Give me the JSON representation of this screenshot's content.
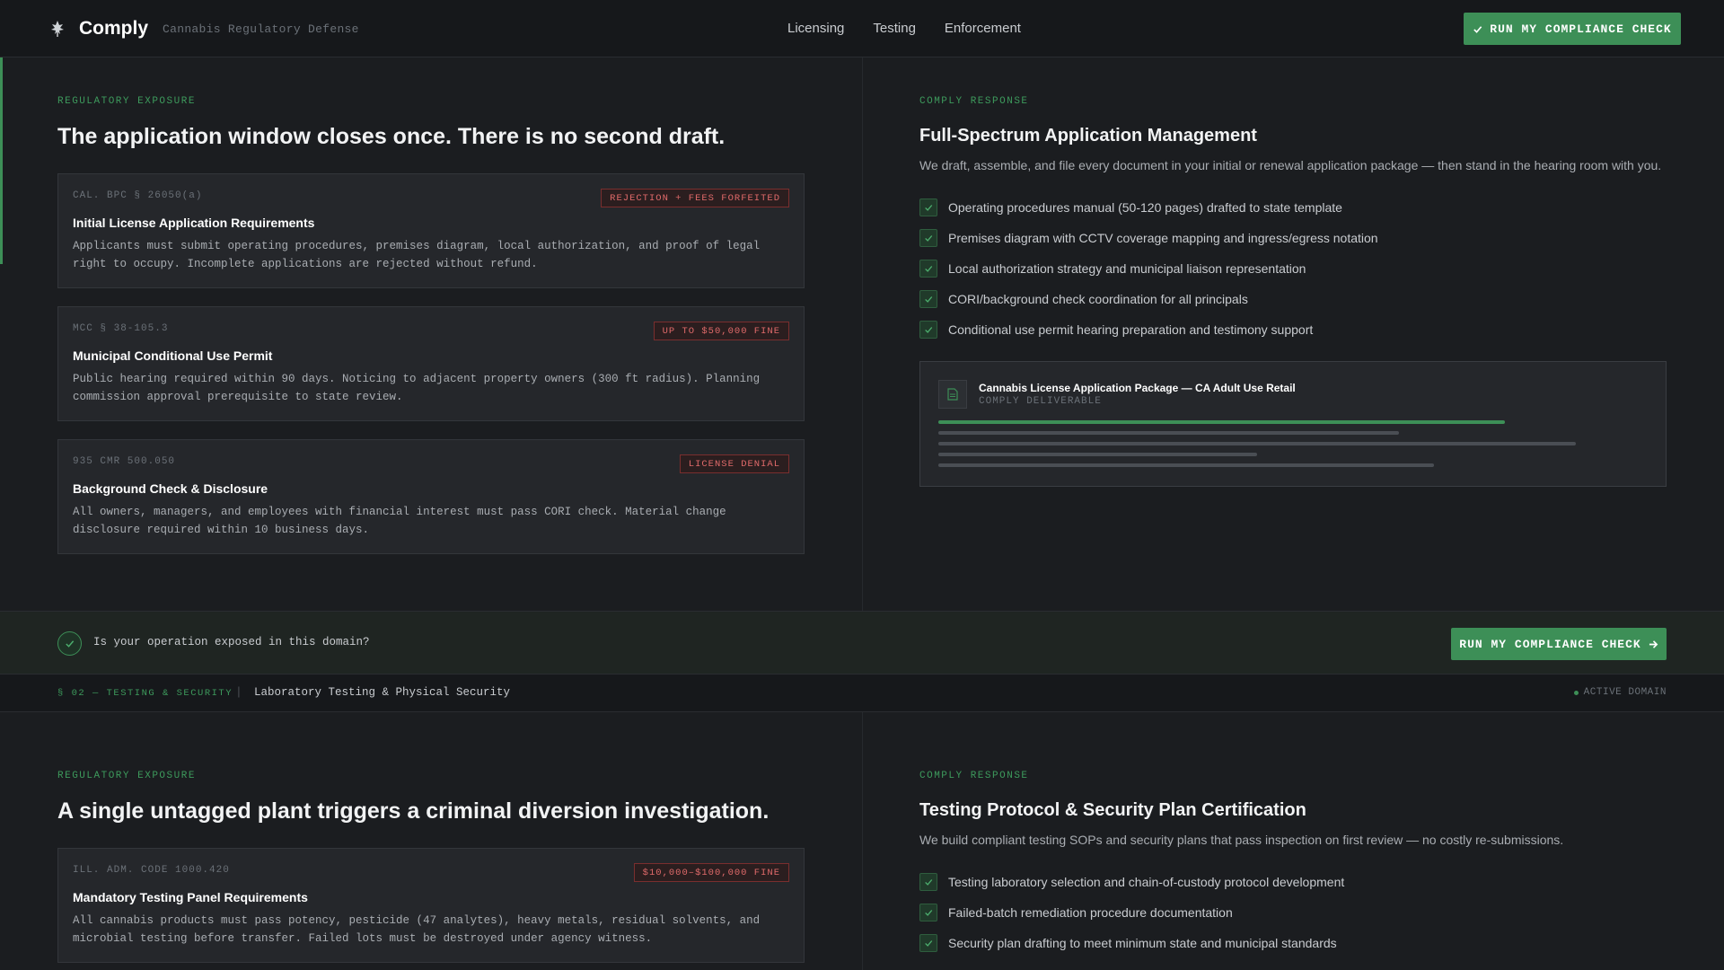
{
  "header": {
    "brand": "Comply",
    "tagline": "Cannabis Regulatory Defense",
    "nav": [
      "Licensing",
      "Testing",
      "Enforcement"
    ],
    "cta": "RUN MY COMPLIANCE CHECK",
    "accent_color": "#3d8f57"
  },
  "section1": {
    "exposure": {
      "label": "REGULATORY EXPOSURE",
      "headline": "The application window closes once. There is no second draft.",
      "cards": [
        {
          "code": "CAL. BPC § 26050(a)",
          "badge": "REJECTION + FEES FORFEITED",
          "title": "Initial License Application Requirements",
          "body": "Applicants must submit operating procedures, premises diagram, local authorization, and proof of legal right to occupy. Incomplete applications are rejected without refund."
        },
        {
          "code": "MCC § 38-105.3",
          "badge": "UP TO $50,000 FINE",
          "title": "Municipal Conditional Use Permit",
          "body": "Public hearing required within 90 days. Noticing to adjacent property owners (300 ft radius). Planning commission approval prerequisite to state review."
        },
        {
          "code": "935 CMR 500.050",
          "badge": "LICENSE DENIAL",
          "title": "Background Check & Disclosure",
          "body": "All owners, managers, and employees with financial interest must pass CORI check. Material change disclosure required within 10 business days."
        }
      ]
    },
    "response": {
      "label": "COMPLY RESPONSE",
      "title": "Full-Spectrum Application Management",
      "description": "We draft, assemble, and file every document in your initial or renewal application package — then stand in the hearing room with you.",
      "items": [
        "Operating procedures manual (50-120 pages) drafted to state template",
        "Premises diagram with CCTV coverage mapping and ingress/egress notation",
        "Local authorization strategy and municipal liaison representation",
        "CORI/background check coordination for all principals",
        "Conditional use permit hearing preparation and testimony support"
      ],
      "deliverable": {
        "title": "Cannabis License Application Package — CA Adult Use Retail",
        "subtitle": "COMPLY DELIVERABLE"
      }
    }
  },
  "cta_strip": {
    "question": "Is your operation exposed in this domain?",
    "button": "RUN MY COMPLIANCE CHECK"
  },
  "domain_bar": {
    "code": "§ 02 — TESTING & SECURITY",
    "separator": "|",
    "name": "Laboratory Testing & Physical Security",
    "status": "ACTIVE DOMAIN"
  },
  "section2": {
    "exposure": {
      "label": "REGULATORY EXPOSURE",
      "headline": "A single untagged plant triggers a criminal diversion investigation.",
      "cards": [
        {
          "code": "ILL. ADM. CODE 1000.420",
          "badge": "$10,000–$100,000 FINE",
          "title": "Mandatory Testing Panel Requirements",
          "body": "All cannabis products must pass potency, pesticide (47 analytes), heavy metals, residual solvents, and microbial testing before transfer. Failed lots must be destroyed under agency witness."
        }
      ]
    },
    "response": {
      "label": "COMPLY RESPONSE",
      "title": "Testing Protocol & Security Plan Certification",
      "description": "We build compliant testing SOPs and security plans that pass inspection on first review — no costly re-submissions.",
      "items": [
        "Testing laboratory selection and chain-of-custody protocol development",
        "Failed-batch remediation procedure documentation",
        "Security plan drafting to meet minimum state and municipal standards"
      ]
    }
  }
}
